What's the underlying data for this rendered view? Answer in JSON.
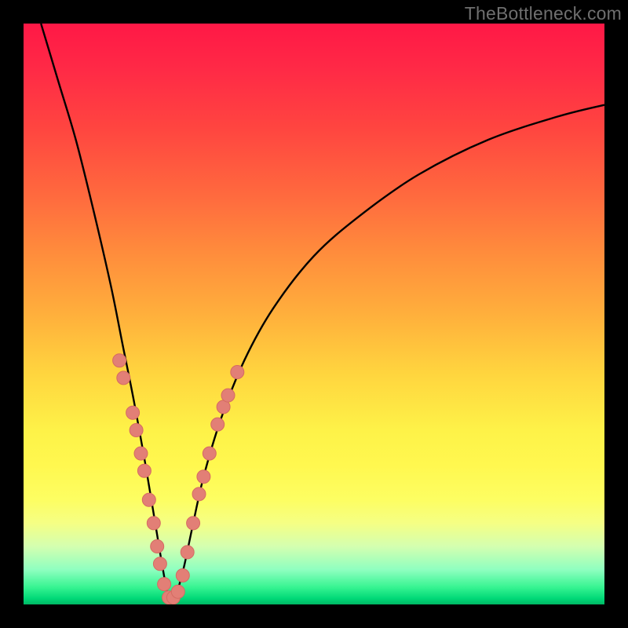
{
  "watermark": {
    "text": "TheBottleneck.com"
  },
  "colors": {
    "frame": "#000000",
    "curve": "#000000",
    "dot_fill": "#e27f76",
    "dot_stroke": "#d56b62"
  },
  "chart_data": {
    "type": "line",
    "title": "",
    "xlabel": "",
    "ylabel": "",
    "xlim": [
      0,
      100
    ],
    "ylim": [
      0,
      100
    ],
    "note": "V-shaped bottleneck curve over red→green vertical gradient. Minimum ≈0 near x≈25. Salmon dots mark sample points along both legs near the bottom.",
    "series": [
      {
        "name": "bottleneck-curve",
        "x": [
          3,
          6,
          9,
          12,
          15,
          17,
          19,
          21,
          22.5,
          24,
          25,
          26,
          27.5,
          29,
          31,
          34,
          38,
          43,
          50,
          58,
          68,
          80,
          92,
          100
        ],
        "values": [
          100,
          90,
          80,
          68,
          55,
          45,
          35,
          24,
          15,
          6,
          1,
          1,
          6,
          13,
          22,
          32,
          42,
          51,
          60,
          67,
          74,
          80,
          84,
          86
        ]
      }
    ],
    "dots": [
      {
        "x": 16.5,
        "y": 42
      },
      {
        "x": 17.2,
        "y": 39
      },
      {
        "x": 18.8,
        "y": 33
      },
      {
        "x": 19.4,
        "y": 30
      },
      {
        "x": 20.2,
        "y": 26
      },
      {
        "x": 20.8,
        "y": 23
      },
      {
        "x": 21.6,
        "y": 18
      },
      {
        "x": 22.4,
        "y": 14
      },
      {
        "x": 23.0,
        "y": 10
      },
      {
        "x": 23.5,
        "y": 7
      },
      {
        "x": 24.2,
        "y": 3.5
      },
      {
        "x": 25.0,
        "y": 1.2
      },
      {
        "x": 25.8,
        "y": 1.2
      },
      {
        "x": 26.6,
        "y": 2.2
      },
      {
        "x": 27.4,
        "y": 5
      },
      {
        "x": 28.2,
        "y": 9
      },
      {
        "x": 29.2,
        "y": 14
      },
      {
        "x": 30.2,
        "y": 19
      },
      {
        "x": 31.0,
        "y": 22
      },
      {
        "x": 32.0,
        "y": 26
      },
      {
        "x": 33.4,
        "y": 31
      },
      {
        "x": 34.4,
        "y": 34
      },
      {
        "x": 35.2,
        "y": 36
      },
      {
        "x": 36.8,
        "y": 40
      }
    ]
  }
}
